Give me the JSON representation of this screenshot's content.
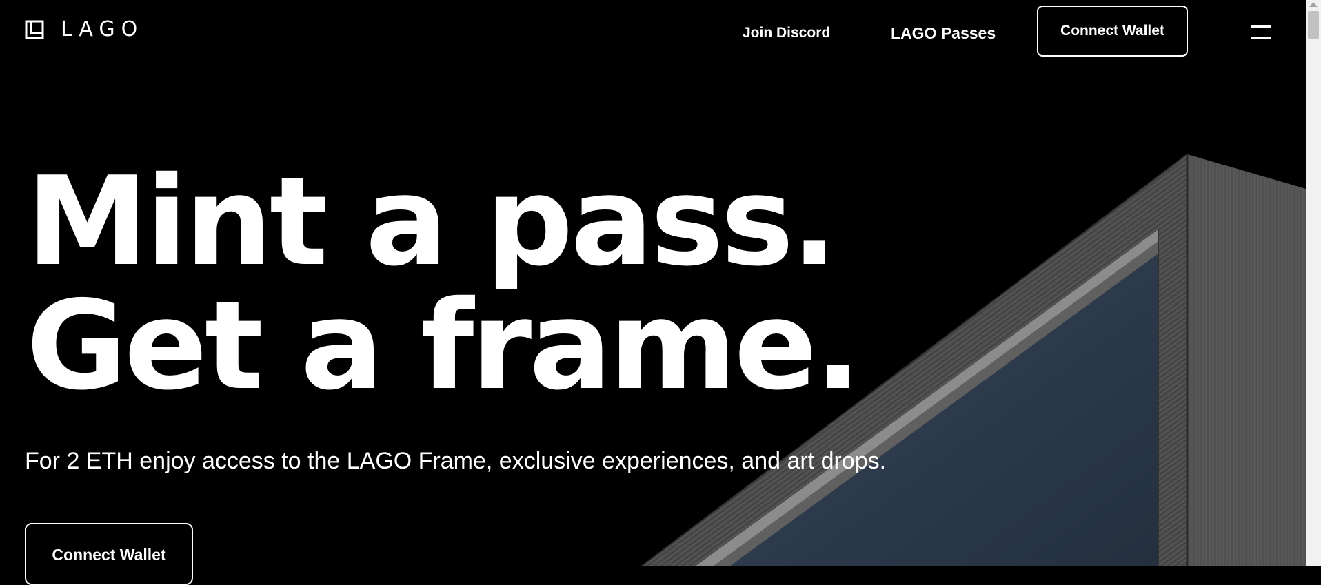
{
  "header": {
    "logo_text": "LAGO",
    "nav_links": [
      "Join Discord",
      "LAGO Passes"
    ],
    "connect_wallet_label": "Connect Wallet",
    "menu_icon": "hamburger-menu-icon"
  },
  "hero": {
    "title_line1": "Mint a pass.",
    "title_line2": "Get a frame.",
    "subtitle": "For 2 ETH enjoy access to the LAGO Frame, exclusive experiences, and art drops.",
    "cta_label": "Connect Wallet"
  },
  "colors": {
    "background": "#000000",
    "text": "#ffffff",
    "frame_wood": "#4a4a4a",
    "frame_screen": "#2c3a4c"
  }
}
